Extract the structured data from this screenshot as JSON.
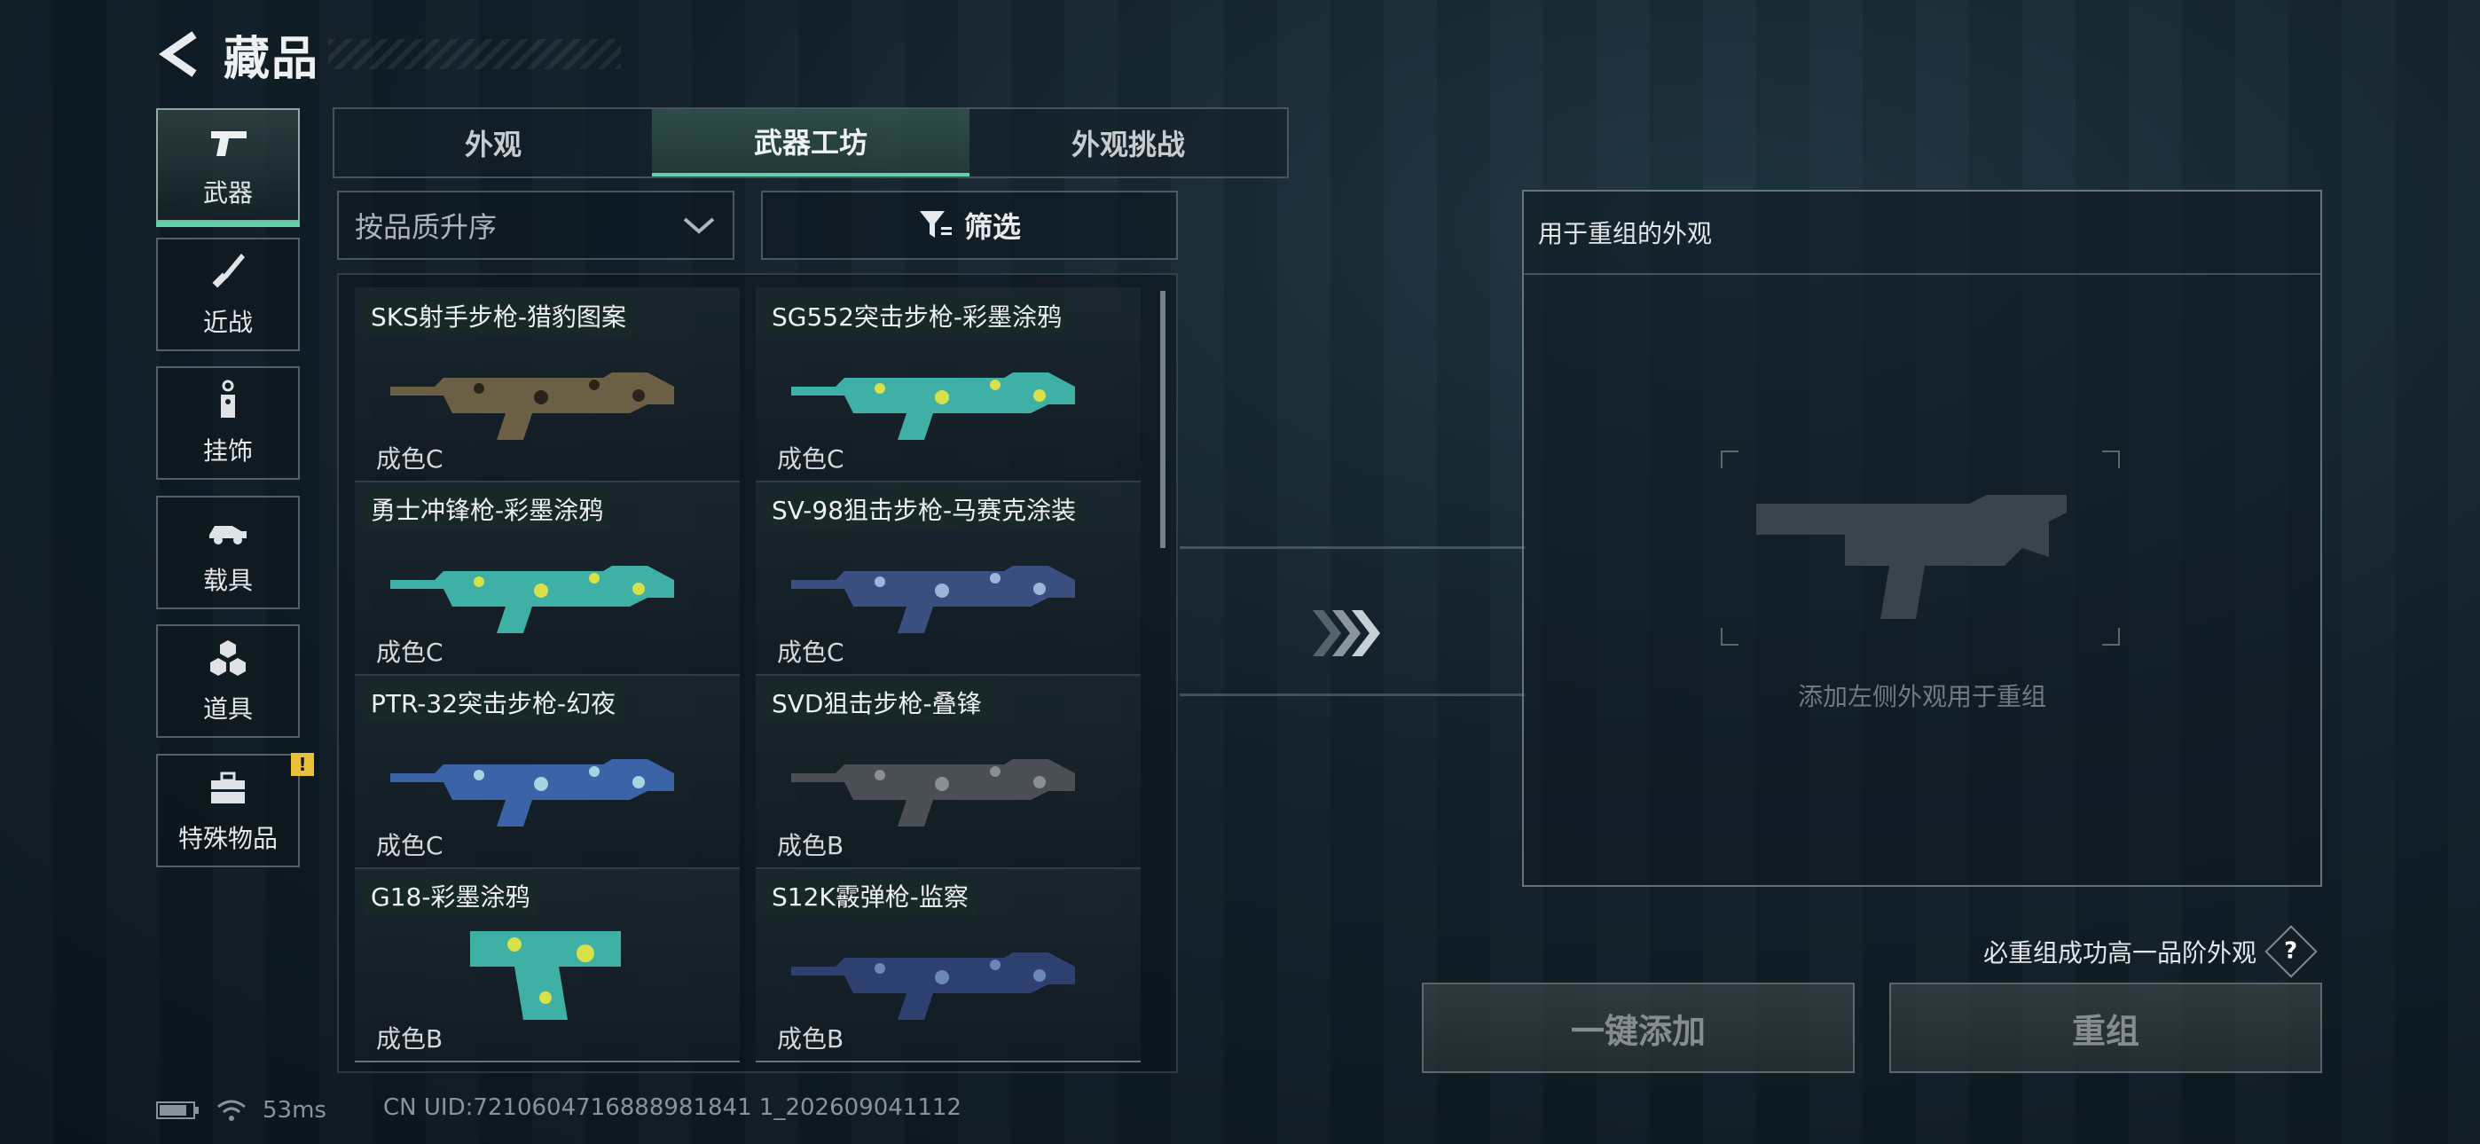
{
  "header": {
    "title": "藏品"
  },
  "categories": [
    {
      "label": "武器",
      "icon": "pistol-icon",
      "active": true
    },
    {
      "label": "近战",
      "icon": "knife-icon",
      "active": false
    },
    {
      "label": "挂饰",
      "icon": "charm-icon",
      "active": false
    },
    {
      "label": "载具",
      "icon": "vehicle-icon",
      "active": false
    },
    {
      "label": "道具",
      "icon": "cubes-icon",
      "active": false
    },
    {
      "label": "特殊物品",
      "icon": "toolbox-icon",
      "active": false,
      "badge": "!"
    }
  ],
  "tabs": [
    {
      "label": "外观",
      "active": false
    },
    {
      "label": "武器工坊",
      "active": true
    },
    {
      "label": "外观挑战",
      "active": false
    }
  ],
  "sort": {
    "label": "按品质升序"
  },
  "filter": {
    "label": "筛选"
  },
  "items": [
    {
      "name": "SKS射手步枪-猎豹图案",
      "condition": "成色C",
      "skin": "leopard"
    },
    {
      "name": "SG552突击步枪-彩墨涂鸦",
      "condition": "成色C",
      "skin": "ink"
    },
    {
      "name": "勇士冲锋枪-彩墨涂鸦",
      "condition": "成色C",
      "skin": "ink"
    },
    {
      "name": "SV-98狙击步枪-马赛克涂装",
      "condition": "成色C",
      "skin": "mosaic"
    },
    {
      "name": "PTR-32突击步枪-幻夜",
      "condition": "成色C",
      "skin": "night"
    },
    {
      "name": "SVD狙击步枪-叠锋",
      "condition": "成色B",
      "skin": "dark"
    },
    {
      "name": "G18-彩墨涂鸦",
      "condition": "成色B",
      "skin": "ink"
    },
    {
      "name": "S12K霰弹枪-监察",
      "condition": "成色B",
      "skin": "blue"
    }
  ],
  "recombine": {
    "title": "用于重组的外观",
    "hint": "添加左侧外观用于重组",
    "guarantee": "必重组成功高一品阶外观",
    "help": "?",
    "add_all": "一键添加",
    "recombine_btn": "重组"
  },
  "status": {
    "ping": "53ms",
    "uid": "CN UID:7210604716888981841 1_202609041112"
  },
  "colors": {
    "accent": "#5fd4a8",
    "badge": "#e8c23a"
  }
}
